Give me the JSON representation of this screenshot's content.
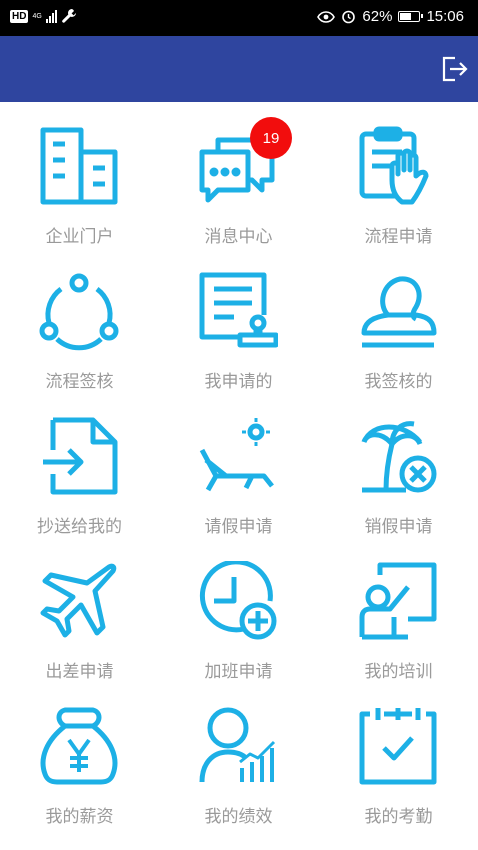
{
  "status_bar": {
    "hd": "HD",
    "network": "4G",
    "battery_percent": "62%",
    "battery_level": 0.62,
    "time": "15:06",
    "icons": [
      "signal-icon",
      "wrench-icon",
      "eye-icon",
      "alarm-icon",
      "battery-icon"
    ]
  },
  "header": {
    "bg_color": "#2f459f",
    "action_icon": "logout-icon"
  },
  "accent_color": "#1db0e6",
  "badge": {
    "count": "19",
    "color": "#f20d0d"
  },
  "grid": [
    {
      "label": "企业门户",
      "icon": "buildings-icon"
    },
    {
      "label": "消息中心",
      "icon": "chat-bubbles-icon"
    },
    {
      "label": "流程申请",
      "icon": "clipboard-hand-icon"
    },
    {
      "label": "流程签核",
      "icon": "share-icon"
    },
    {
      "label": "我申请的",
      "icon": "document-stamp-icon"
    },
    {
      "label": "我签核的",
      "icon": "stamp-icon"
    },
    {
      "label": "抄送给我的",
      "icon": "file-import-icon"
    },
    {
      "label": "请假申请",
      "icon": "lounge-chair-icon"
    },
    {
      "label": "销假申请",
      "icon": "palm-tree-cancel-icon"
    },
    {
      "label": "出差申请",
      "icon": "airplane-icon"
    },
    {
      "label": "加班申请",
      "icon": "clock-plus-icon"
    },
    {
      "label": "我的培训",
      "icon": "trainer-board-icon"
    },
    {
      "label": "我的薪资",
      "icon": "money-bag-icon"
    },
    {
      "label": "我的绩效",
      "icon": "user-chart-icon"
    },
    {
      "label": "我的考勤",
      "icon": "calendar-check-icon"
    }
  ]
}
